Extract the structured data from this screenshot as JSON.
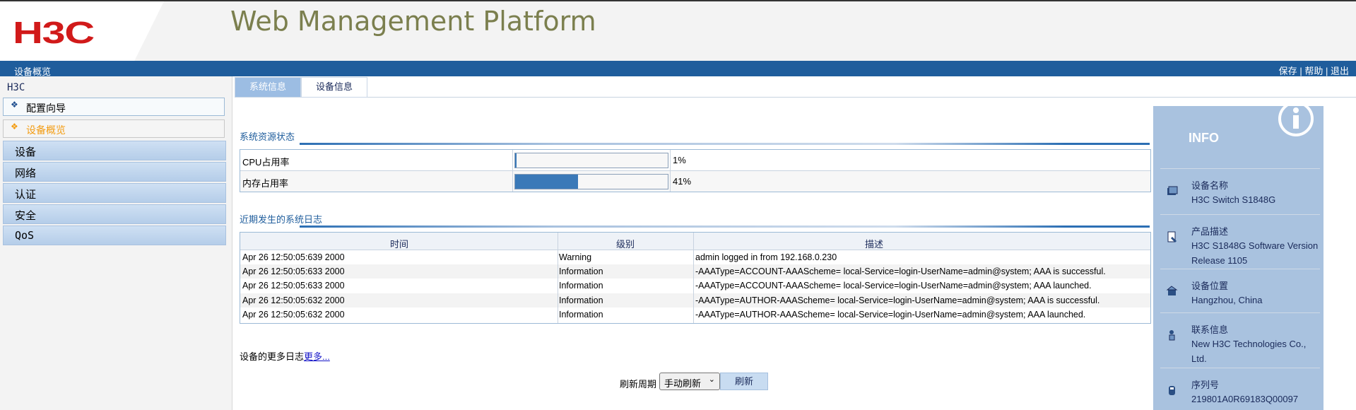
{
  "header": {
    "logo_text": "H3C",
    "app_title": "Web Management Platform",
    "breadcrumb": "设备概览",
    "links": [
      "保存",
      "帮助",
      "退出"
    ],
    "link_separator": "|"
  },
  "sidebar": {
    "root": "H3C",
    "links": [
      {
        "label": "配置向导",
        "active": false
      },
      {
        "label": "设备概览",
        "active": true
      }
    ],
    "categories": [
      "设备",
      "网络",
      "认证",
      "安全",
      "QoS"
    ]
  },
  "tabs": [
    {
      "label": "系统信息",
      "selected": true
    },
    {
      "label": "设备信息",
      "selected": false
    }
  ],
  "resources": {
    "title": "系统资源状态",
    "rows": [
      {
        "label": "CPU占用率",
        "value": 1,
        "display": "1%"
      },
      {
        "label": "内存占用率",
        "value": 41,
        "display": "41%"
      }
    ]
  },
  "logs": {
    "title": "近期发生的系统日志",
    "headers": [
      "时间",
      "级别",
      "描述"
    ],
    "rows": [
      [
        "Apr 26 12:50:05:639 2000",
        "Warning",
        "admin logged in from 192.168.0.230"
      ],
      [
        "Apr 26 12:50:05:633 2000",
        "Information",
        "-AAAType=ACCOUNT-AAAScheme= local-Service=login-UserName=admin@system; AAA is successful."
      ],
      [
        "Apr 26 12:50:05:633 2000",
        "Information",
        "-AAAType=ACCOUNT-AAAScheme= local-Service=login-UserName=admin@system; AAA launched."
      ],
      [
        "Apr 26 12:50:05:632 2000",
        "Information",
        "-AAAType=AUTHOR-AAAScheme= local-Service=login-UserName=admin@system; AAA is successful."
      ],
      [
        "Apr 26 12:50:05:632 2000",
        "Information",
        "-AAAType=AUTHOR-AAAScheme= local-Service=login-UserName=admin@system; AAA launched."
      ]
    ],
    "more_text": "设备的更多日志",
    "more_link": "更多..."
  },
  "refresh": {
    "label": "刷新周期",
    "selected": "手动刷新",
    "button": "刷新"
  },
  "info": {
    "title": "INFO",
    "items": [
      {
        "key": "设备名称",
        "value": "H3C Switch S1848G",
        "icon": "device-icon"
      },
      {
        "key": "产品描述",
        "value": "H3C S1848G Software Version Release 1105",
        "icon": "document-icon"
      },
      {
        "key": "设备位置",
        "value": "Hangzhou, China",
        "icon": "location-icon"
      },
      {
        "key": "联系信息",
        "value": "New H3C Technologies Co., Ltd.",
        "icon": "contact-icon"
      },
      {
        "key": "序列号",
        "value": "219801A0R69183Q00097",
        "icon": "serial-icon"
      }
    ]
  },
  "colors": {
    "brand_red": "#d11a1a",
    "nav_blue": "#1f5d9c",
    "active_orange": "#f39c12",
    "info_panel": "#a9c2df",
    "bar_fill": "#3a79b8"
  }
}
